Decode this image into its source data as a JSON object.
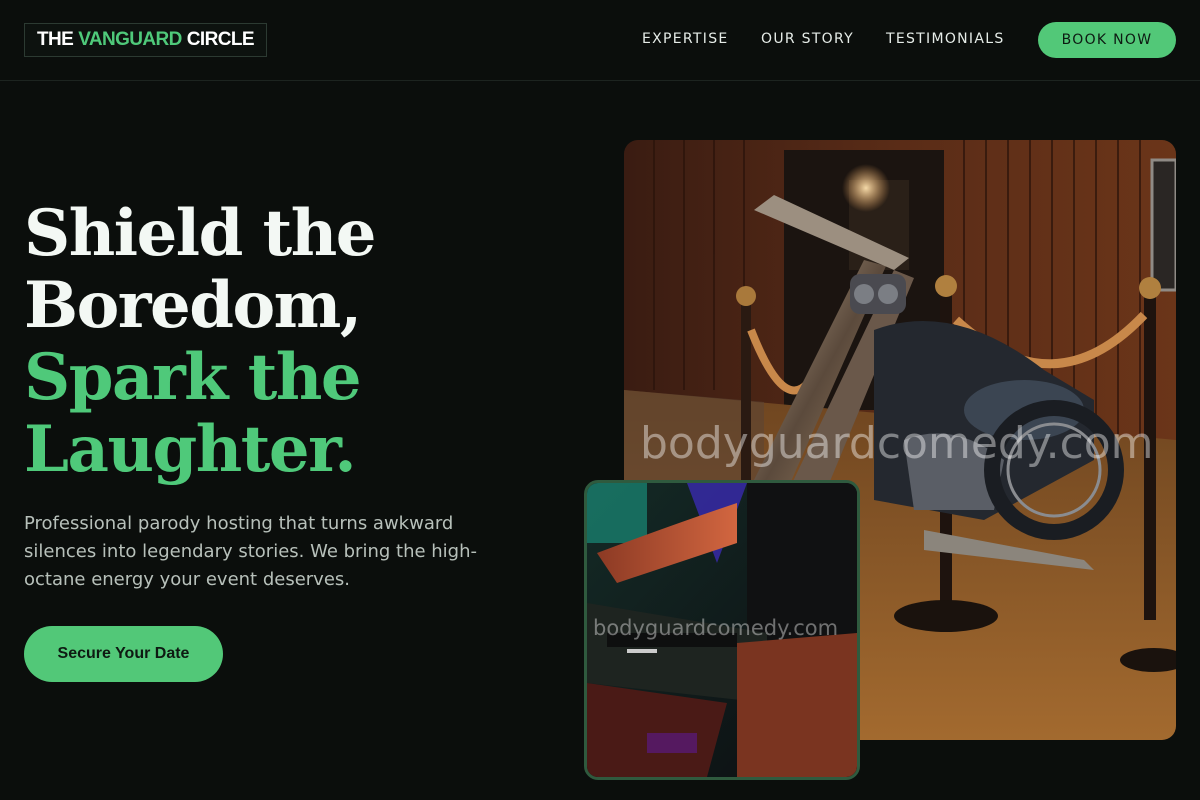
{
  "header": {
    "logo": {
      "part1": "THE",
      "accent": "VANGUARD",
      "part2": "CIRCLE"
    },
    "nav": [
      {
        "label": "EXPERTISE"
      },
      {
        "label": "OUR STORY"
      },
      {
        "label": "TESTIMONIALS"
      }
    ],
    "book_button": "BOOK NOW"
  },
  "hero": {
    "headline_line1": "Shield the",
    "headline_line2": "Boredom,",
    "headline_line3": "Spark the",
    "headline_line4": "Laughter.",
    "subtext": "Professional parody hosting that turns awkward silences into legendary stories. We bring the high-octane energy your event deserves.",
    "cta": "Secure Your Date"
  },
  "images": {
    "main_watermark": "bodyguardcomedy.com",
    "side_watermark": "bodyguardcomedy.com"
  },
  "colors": {
    "background": "#0b0e0c",
    "accent": "#52c878",
    "headline_green": "#4fc97a",
    "text_muted": "#b7c0ba"
  }
}
